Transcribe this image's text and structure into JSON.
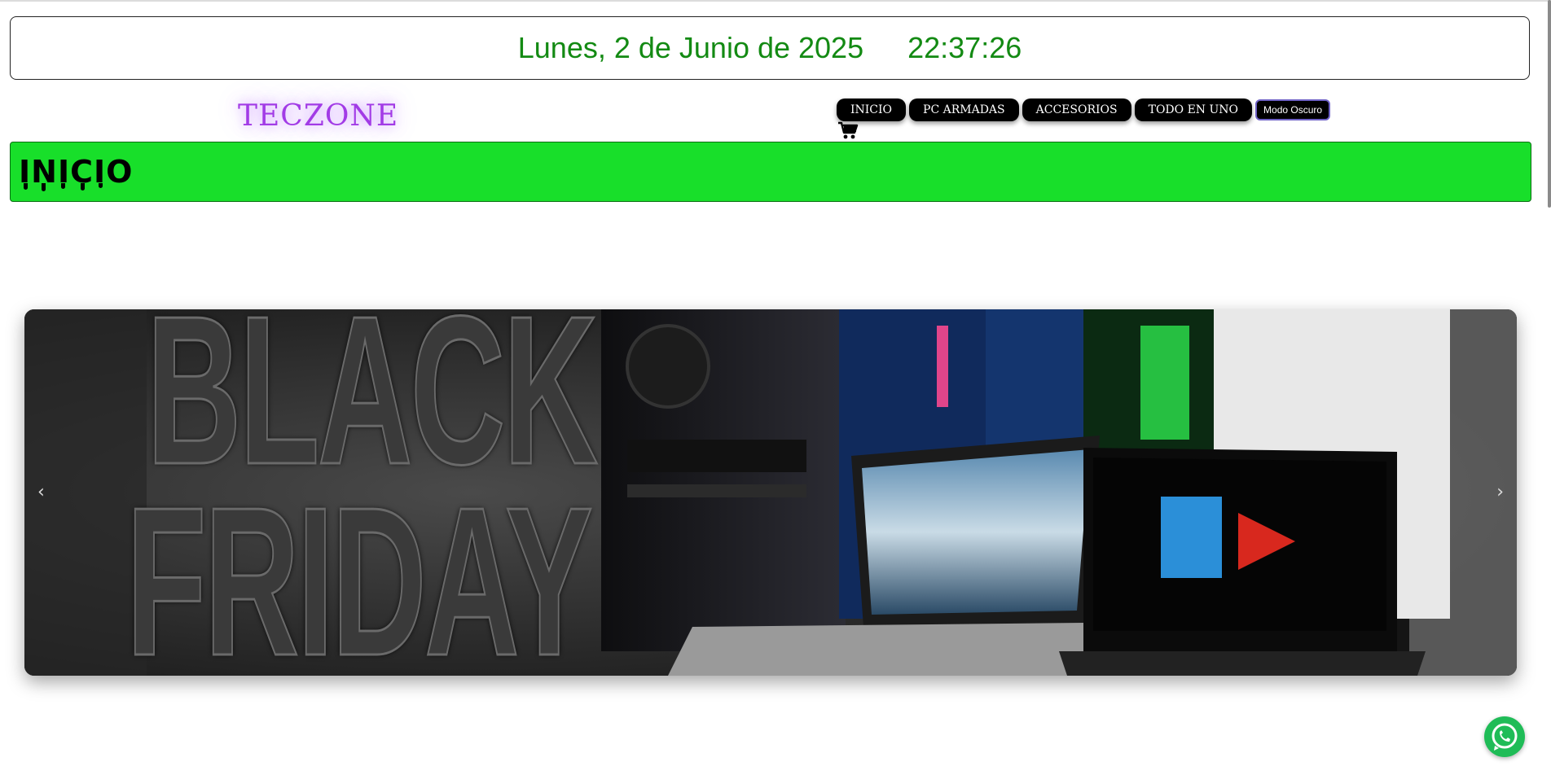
{
  "datetime": {
    "date": "Lunes, 2 de Junio de 2025",
    "time": "22:37:26"
  },
  "brand": {
    "logo": "TECZONE"
  },
  "nav": {
    "items": [
      {
        "label": "INICIO"
      },
      {
        "label": "PC ARMADAS"
      },
      {
        "label": "ACCESORIOS"
      },
      {
        "label": "TODO EN UNO"
      }
    ],
    "dark_mode_label": "Modo Oscuro"
  },
  "section": {
    "title": "INICIO"
  },
  "carousel": {
    "line1": "BLACK",
    "line2": "FRIDAY",
    "prev_icon": "chevron-left-icon",
    "next_icon": "chevron-right-icon"
  },
  "colors": {
    "date_green": "#138a13",
    "section_green": "#18df2a",
    "logo_purple": "#a23be6",
    "whatsapp_green": "#1fbc57"
  },
  "icons": {
    "cart": "cart-icon",
    "whatsapp": "whatsapp-icon"
  }
}
